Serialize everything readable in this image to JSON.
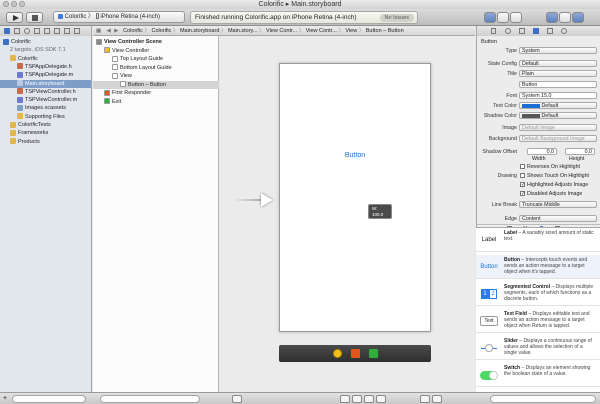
{
  "window": {
    "title_project": "Colorific",
    "title_file": "Main.storyboard"
  },
  "toolbar": {
    "scheme_target": "Colorific",
    "scheme_device": "iPhone Retina (4-inch)",
    "activity_text": "Finished running Colorific.app on iPhone Retina (4-inch)",
    "issues_badge": "No Issues"
  },
  "navigator": {
    "items": [
      {
        "label": "Colorific",
        "level": 0,
        "kind": "project",
        "selected": false
      },
      {
        "label": "2 targets, iOS SDK 7.1",
        "level": 1,
        "kind": "subtitle",
        "selected": false
      },
      {
        "label": "Colorific",
        "level": 1,
        "kind": "folder",
        "selected": false
      },
      {
        "label": "TSPAppDelegate.h",
        "level": 2,
        "kind": "h",
        "selected": false
      },
      {
        "label": "TSPAppDelegate.m",
        "level": 2,
        "kind": "m",
        "selected": false
      },
      {
        "label": "Main.storyboard",
        "level": 2,
        "kind": "storyboard",
        "selected": true
      },
      {
        "label": "TSPViewController.h",
        "level": 2,
        "kind": "h",
        "selected": false
      },
      {
        "label": "TSPViewController.m",
        "level": 2,
        "kind": "m",
        "selected": false
      },
      {
        "label": "Images.xcassets",
        "level": 2,
        "kind": "assets",
        "selected": false
      },
      {
        "label": "Supporting Files",
        "level": 2,
        "kind": "folder",
        "selected": false
      },
      {
        "label": "ColorificTests",
        "level": 1,
        "kind": "folder",
        "selected": false
      },
      {
        "label": "Frameworks",
        "level": 1,
        "kind": "folder",
        "selected": false
      },
      {
        "label": "Products",
        "level": 1,
        "kind": "folder",
        "selected": false
      }
    ]
  },
  "jumpbar": {
    "crumbs": [
      "Colorific",
      "Colorific",
      "Main.storyboard",
      "Main.story...",
      "View Contr...",
      "View Contr...",
      "View",
      "Button – Button"
    ]
  },
  "outline": {
    "items": [
      {
        "label": "View Controller Scene",
        "level": 0,
        "bold": true,
        "selected": false
      },
      {
        "label": "View Controller",
        "level": 1,
        "bold": false,
        "selected": false
      },
      {
        "label": "Top Layout Guide",
        "level": 2,
        "bold": false,
        "selected": false
      },
      {
        "label": "Bottom Layout Guide",
        "level": 2,
        "bold": false,
        "selected": false
      },
      {
        "label": "View",
        "level": 2,
        "bold": false,
        "selected": false
      },
      {
        "label": "Button – Button",
        "level": 3,
        "bold": false,
        "selected": true
      },
      {
        "label": "First Responder",
        "level": 1,
        "bold": false,
        "selected": false
      },
      {
        "label": "Exit",
        "level": 1,
        "bold": false,
        "selected": false
      }
    ]
  },
  "canvas": {
    "button_title": "Button",
    "size_w": "W: 100.0",
    "size_h": "H: 195.0"
  },
  "inspector": {
    "section_title": "Button",
    "type_label": "Type",
    "type_value": "System",
    "state_label": "State Config",
    "state_value": "Default",
    "title_label": "Title",
    "title_mode": "Plain",
    "title_text": "Button",
    "font_label": "Font",
    "font_value": "System 15.0",
    "textcolor_label": "Text Color",
    "textcolor_value": "Default",
    "shadowcolor_label": "Shadow Color",
    "shadowcolor_value": "Default",
    "image_label": "Image",
    "image_placeholder": "Default Image",
    "background_label": "Background",
    "background_placeholder": "Default Background Image",
    "shadowoffset_label": "Shadow Offset",
    "offset_width": "0,0",
    "offset_height": "0,0",
    "width_caption": "Width",
    "height_caption": "Height",
    "drawing_label": "Drawing",
    "chk_reverses": "Reverses On Highlight",
    "chk_shows_touch": "Shows Touch On Highlight",
    "chk_highlighted": "Highlighted Adjusts Image",
    "chk_disabled": "Disabled Adjusts Image",
    "linebreak_label": "Line Break",
    "linebreak_value": "Truncate Middle",
    "edge_label": "Edge",
    "edge_value": "Content"
  },
  "library": {
    "items": [
      {
        "icon": "Label",
        "title": "Label",
        "desc": " – A variably sized amount of static text."
      },
      {
        "icon": "Button",
        "title": "Button",
        "desc": " – Intercepts touch events and sends an action message to a target object when it's tapped."
      },
      {
        "icon": "12",
        "title": "Segmented Control",
        "desc": " – Displays multiple segments, each of which functions as a discrete button."
      },
      {
        "icon": "Text",
        "title": "Text Field",
        "desc": " – Displays editable text and sends an action message to a target object when Return is tapped."
      },
      {
        "icon": "slider",
        "title": "Slider",
        "desc": " – Displays a continuous range of values and allows the selection of a single value."
      },
      {
        "icon": "switch",
        "title": "Switch",
        "desc": " – Displays an element showing the boolean state of a value."
      }
    ]
  },
  "colors": {
    "selection": "#7e9ec9",
    "accent_blue": "#1a6ed8",
    "text_color_swatch": "#1a6ed8",
    "dock": "#3a3a3a"
  }
}
